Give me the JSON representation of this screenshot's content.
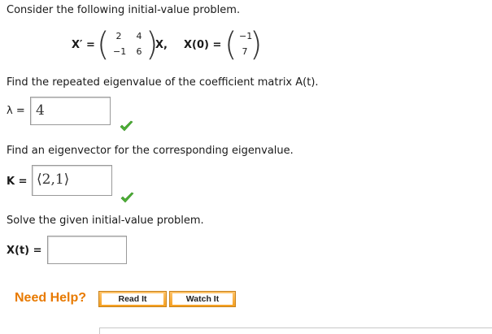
{
  "q1": {
    "intro": "Consider the following initial-value problem.",
    "eq_lhs": "X′ =",
    "matrix_row1": [
      "2",
      "4"
    ],
    "matrix_row2": [
      "−1",
      "6"
    ],
    "eq_var": "X,",
    "ic_lhs": "X(0) =",
    "ic_vec": [
      "−1",
      "7"
    ]
  },
  "q2": {
    "prompt": "Find the repeated eigenvalue of the coefficient matrix A(t).",
    "label": "λ =",
    "value": "4",
    "status": "correct"
  },
  "q3": {
    "prompt": "Find an eigenvector for the corresponding eigenvalue.",
    "label": "K =",
    "value": "⟨2,1⟩",
    "status": "correct"
  },
  "q4": {
    "prompt": "Solve the given initial-value problem.",
    "label": "X(t) =",
    "value": ""
  },
  "help": {
    "title": "Need Help?",
    "read_label": "Read It",
    "watch_label": "Watch It"
  },
  "colors": {
    "accent_orange": "#e87a00",
    "check_green": "#4caf35"
  }
}
